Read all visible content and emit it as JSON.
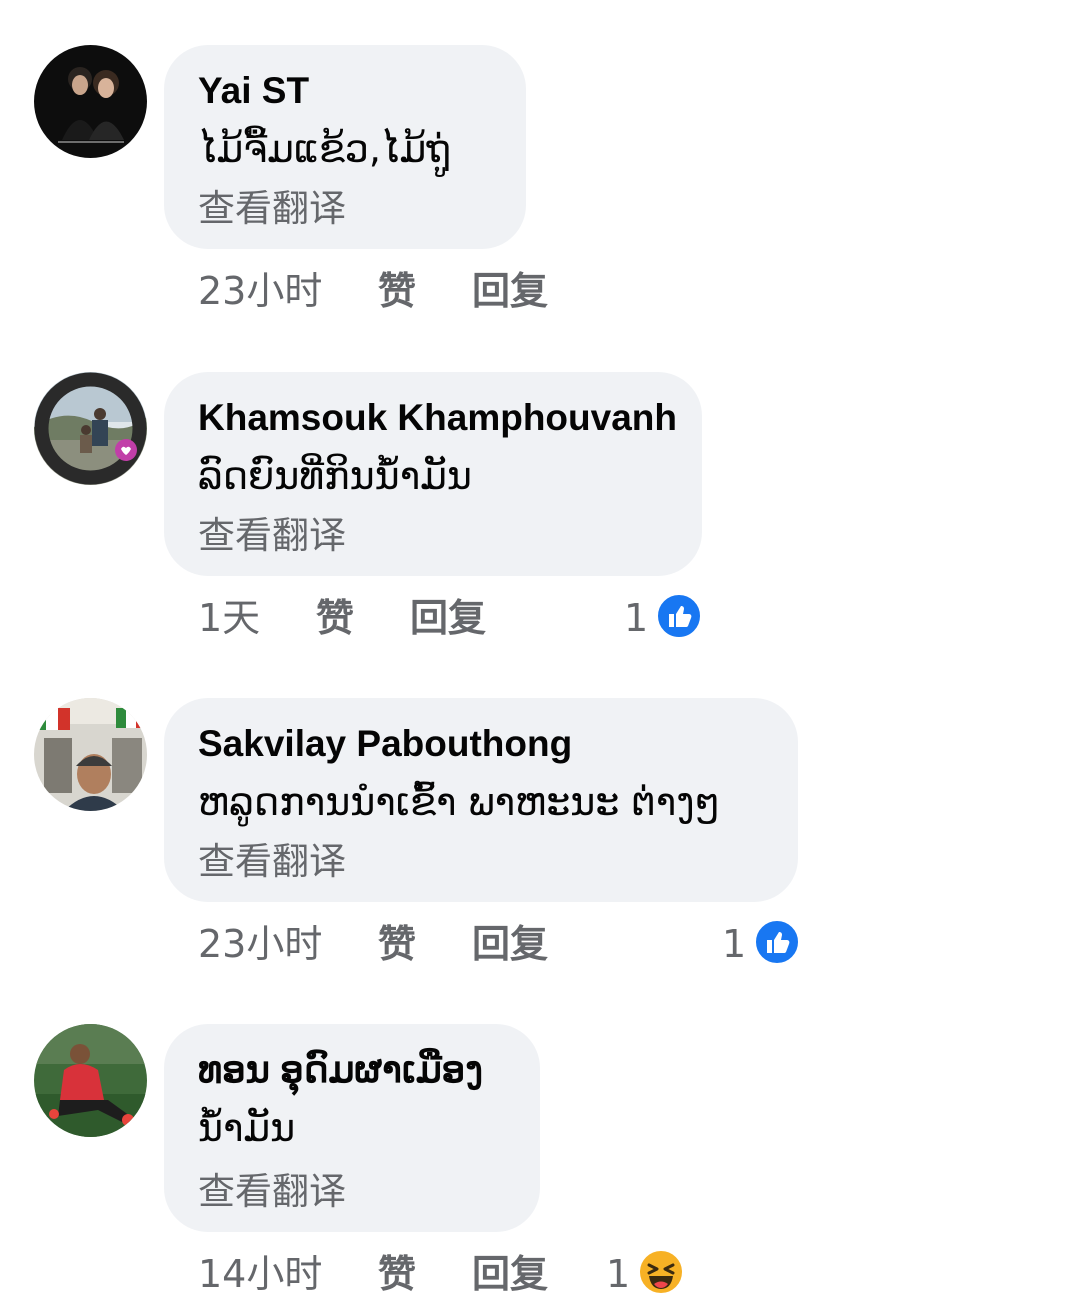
{
  "see_translation_label": "查看翻译",
  "like_label": "赞",
  "reply_label": "回复",
  "colors": {
    "bubble": "#f0f2f5",
    "meta_text": "#65676b",
    "like_blue": "#1877f2",
    "haha_yellow": "#f7b125"
  },
  "comments": [
    {
      "author": "Yai ST",
      "text": "ໄມ້ຈື້ມແຂ້ວ,ໄມ້ຖູ່",
      "time": "23小时",
      "reaction_count": "",
      "reaction_icon": ""
    },
    {
      "author": "Khamsouk Khamphouvanh",
      "text": "ລົດຍົນທີ່ກິນນໍ້າມັນ",
      "time": "1天",
      "reaction_count": "1",
      "reaction_icon": "like-reaction-icon"
    },
    {
      "author": "Sakvilay Pabouthong",
      "text": "ຫລູດການນໍາເຂົ້າ ພາຫະນະ ຕ່າງໆ",
      "time": "23小时",
      "reaction_count": "1",
      "reaction_icon": "like-reaction-icon"
    },
    {
      "author": "ທອນ ອຸດົມຜາເມືອງ",
      "text": "ນໍ້າມັນ",
      "time": "14小时",
      "reaction_count": "1",
      "reaction_icon": "haha-reaction-icon"
    }
  ]
}
